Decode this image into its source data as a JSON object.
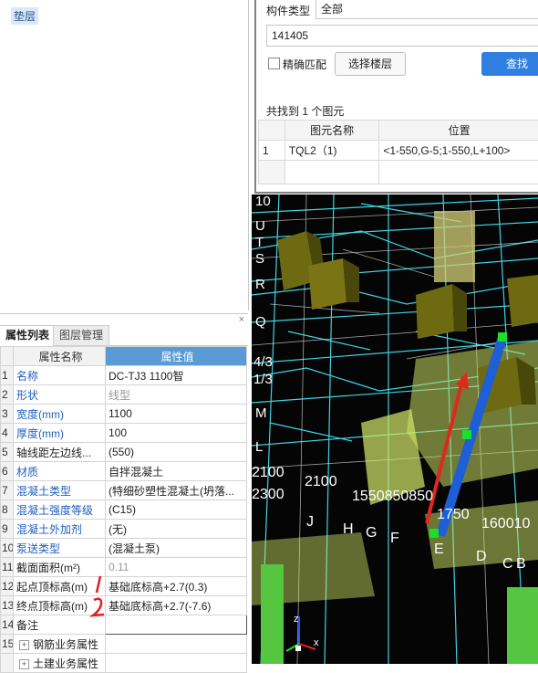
{
  "tree": {
    "node_label": "垫层"
  },
  "props": {
    "tabs": [
      "属性列表",
      "图层管理"
    ],
    "close_glyph": "×",
    "col_name": "属性名称",
    "col_value": "属性值",
    "rows": [
      {
        "idx": "1",
        "name": "名称",
        "value": "DC-TJ3 1100智",
        "style": "blue",
        "vstyle": "plain"
      },
      {
        "idx": "2",
        "name": "形状",
        "value": "线型",
        "style": "blue",
        "vstyle": "gray"
      },
      {
        "idx": "3",
        "name": "宽度(mm)",
        "value": "1100",
        "style": "blue",
        "vstyle": "plain"
      },
      {
        "idx": "4",
        "name": "厚度(mm)",
        "value": "100",
        "style": "blue",
        "vstyle": "plain"
      },
      {
        "idx": "5",
        "name": "轴线距左边线...",
        "value": "(550)",
        "style": "plain",
        "vstyle": "plain"
      },
      {
        "idx": "6",
        "name": "材质",
        "value": "自拌混凝土",
        "style": "blue",
        "vstyle": "plain"
      },
      {
        "idx": "7",
        "name": "混凝土类型",
        "value": "(特细砂塑性混凝土(坍落...",
        "style": "blue",
        "vstyle": "plain"
      },
      {
        "idx": "8",
        "name": "混凝土强度等级",
        "value": "(C15)",
        "style": "blue",
        "vstyle": "plain"
      },
      {
        "idx": "9",
        "name": "混凝土外加剂",
        "value": "(无)",
        "style": "blue",
        "vstyle": "plain"
      },
      {
        "idx": "10",
        "name": "泵送类型",
        "value": "(混凝土泵)",
        "style": "blue",
        "vstyle": "plain"
      },
      {
        "idx": "11",
        "name": "截面面积(m²)",
        "value": "0.11",
        "style": "plain",
        "vstyle": "gray"
      },
      {
        "idx": "12",
        "name": "起点顶标高(m)",
        "value": "基础底标高+2.7(0.3)",
        "style": "plain",
        "vstyle": "plain"
      },
      {
        "idx": "13",
        "name": "终点顶标高(m)",
        "value": "基础底标高+2.7(-7.6)",
        "style": "plain",
        "vstyle": "plain"
      },
      {
        "idx": "14",
        "name": "备注",
        "value": "",
        "style": "plain",
        "vstyle": "sel"
      },
      {
        "idx": "15",
        "name": "钢筋业务属性",
        "value": "",
        "style": "plain",
        "vstyle": "plain",
        "expander": "+"
      },
      {
        "idx": "",
        "name": "土建业务属性",
        "value": "",
        "style": "plain",
        "vstyle": "plain",
        "expander": "+"
      }
    ],
    "annotation_marks": [
      "1",
      "2"
    ]
  },
  "search": {
    "type_label": "构件类型",
    "type_value": "全部",
    "query_value": "141405",
    "exact_match_label": "精确匹配",
    "select_floor_label": "选择楼层",
    "search_button": "查找",
    "result_summary": "共找到 1 个图元",
    "col_name": "图元名称",
    "col_position": "位置",
    "results": [
      {
        "idx": "1",
        "name": "TQL2（1)",
        "position": "<1-550,G-5;1-550,L+100>"
      }
    ]
  },
  "viewport": {
    "left_axis_labels": [
      "10",
      "U",
      "T",
      "S",
      "R",
      "Q",
      "4/3",
      "1/3",
      "M",
      "L"
    ],
    "dimension_labels": [
      "2100",
      "2100",
      "2300",
      "1550850850",
      "1750",
      "160010"
    ],
    "grid_letters": [
      "J",
      "H",
      "G",
      "F",
      "E",
      "D",
      "C",
      "B"
    ],
    "colors": {
      "bg": "#050505",
      "slab": "#d4e86a",
      "column": "#6e6a12",
      "cyan_line": "#3fd3e0",
      "red_arrow": "#e0281c",
      "blue_beam": "#1e5fd8",
      "green_grip": "#19e02a"
    }
  }
}
